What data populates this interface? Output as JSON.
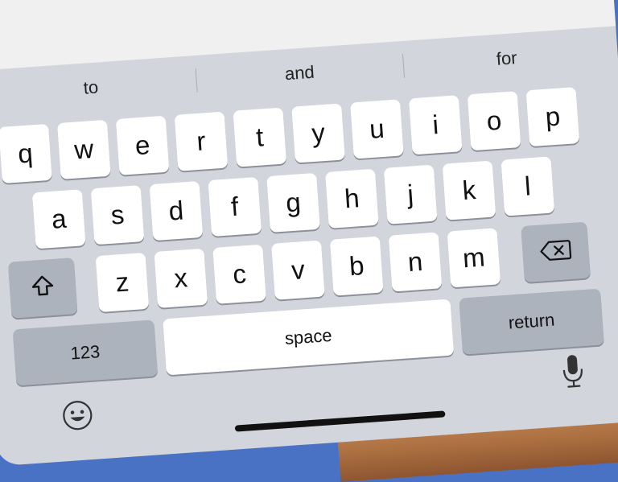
{
  "suggestions": [
    "to",
    "and",
    "for"
  ],
  "rows": {
    "row1": [
      "q",
      "w",
      "e",
      "r",
      "t",
      "y",
      "u",
      "i",
      "o",
      "p"
    ],
    "row2": [
      "a",
      "s",
      "d",
      "f",
      "g",
      "h",
      "j",
      "k",
      "l"
    ],
    "row3": [
      "z",
      "x",
      "c",
      "v",
      "b",
      "n",
      "m"
    ]
  },
  "keys": {
    "numbers": "123",
    "space": "space",
    "return": "return"
  },
  "icons": {
    "shift": "shift-icon",
    "delete": "backspace-icon",
    "emoji": "emoji-icon",
    "dictation": "microphone-icon"
  },
  "colors": {
    "keyboard_bg": "#d2d5dc",
    "letter_key": "#ffffff",
    "function_key": "#adb3bd",
    "background": "#4a72c4"
  }
}
